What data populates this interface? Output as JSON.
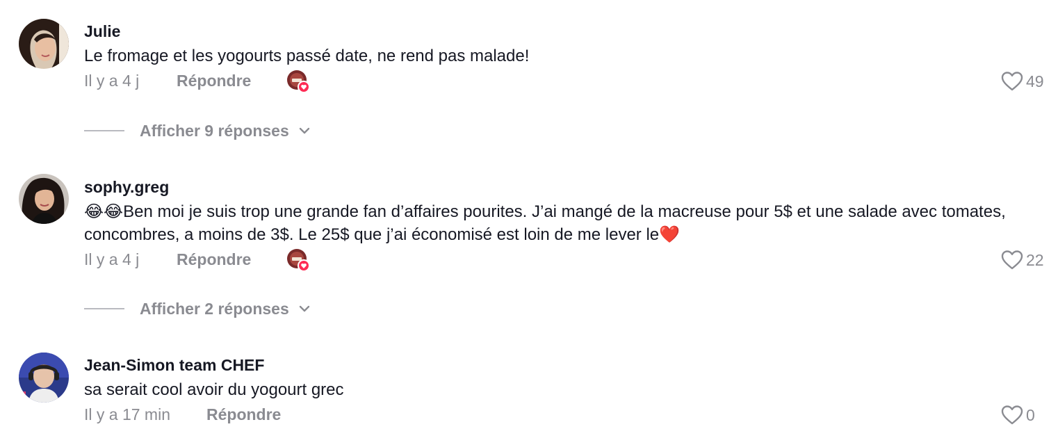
{
  "comments": [
    {
      "username": "Julie",
      "text": "Le fromage et les yogourts passé date, ne rend pas malade!",
      "time": "Il y a 4 j",
      "reply_label": "Répondre",
      "likes": "49",
      "has_creator_like": true,
      "view_replies": "Afficher 9 réponses"
    },
    {
      "username": "sophy.greg",
      "text_prefix_emoji": "😂😂",
      "text": "Ben moi je suis trop une grande fan d’affaires pourites. J’ai mangé de la macreuse pour 5$ et une salade avec tomates, concombres, a moins de 3$. Le 25$ que j’ai économisé est loin de me lever le",
      "text_suffix_emoji": "❤️",
      "time": "Il y a 4 j",
      "reply_label": "Répondre",
      "likes": "22",
      "has_creator_like": true,
      "view_replies": "Afficher 2 réponses"
    },
    {
      "username": "Jean-Simon team CHEF",
      "text": "sa serait cool avoir du yogourt grec",
      "time": "Il y a 17 min",
      "reply_label": "Répondre",
      "likes": "0",
      "has_creator_like": false
    }
  ],
  "icons": {
    "like": "heart-outline-icon",
    "chevron": "chevron-down-icon",
    "creator_badge": "creator-liked-badge-icon"
  },
  "colors": {
    "text_primary": "#161823",
    "text_secondary": "#8a8b91",
    "accent_red": "#fe2c55"
  }
}
